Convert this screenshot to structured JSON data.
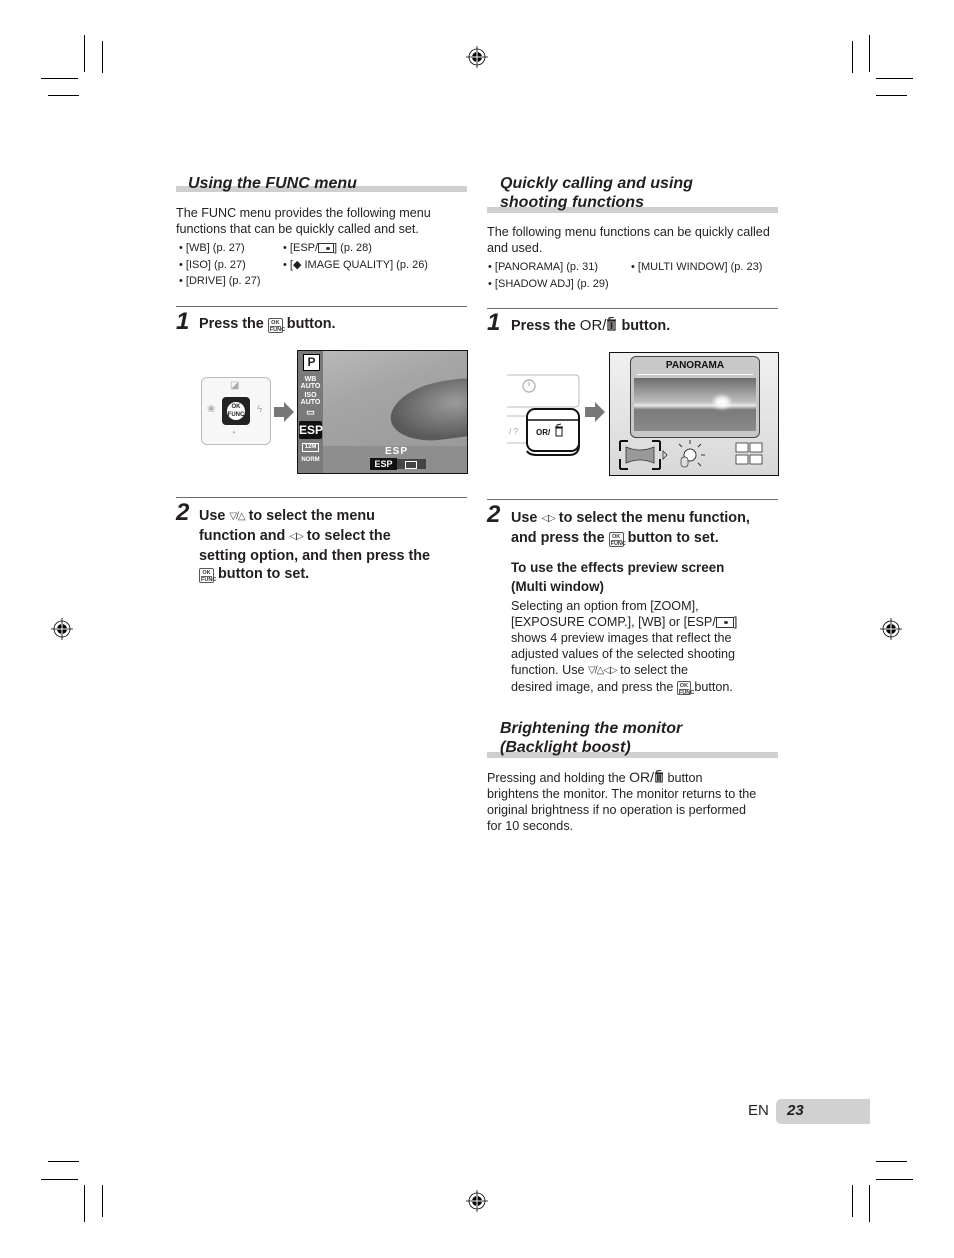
{
  "page": {
    "language": "EN",
    "number": "23"
  },
  "left": {
    "section_title": "Using the FUNC menu",
    "intro": "The FUNC menu provides the following menu functions that can be quickly called and set.",
    "bullets_col1": [
      "[WB] (p. 27)",
      "[ISO] (p. 27)",
      "[DRIVE] (p. 27)"
    ],
    "bullets_col2_esp_prefix": "[ESP/",
    "bullets_col2_esp_suffix": "] (p. 28)",
    "bullets_col2_quality": "[◆ IMAGE QUALITY] (p. 26)",
    "step1": {
      "number": "1",
      "prefix": "Press the",
      "suffix": "button."
    },
    "step2": {
      "number": "2",
      "line1_prefix": "Use",
      "line1_suffix": "to select the menu",
      "line2_prefix": "function and",
      "line2_suffix": "to select the",
      "line3": "setting option, and then press the",
      "line4_suffix": "button to set."
    },
    "illustration": {
      "ok_top": "OK",
      "ok_bottom": "FUNC",
      "mode": "P",
      "side_items": [
        "WB AUTO",
        "ISO AUTO",
        "▭",
        "ESP",
        "12M",
        "NORM"
      ],
      "selected": "ESP",
      "bottom_label": "ESP",
      "option_selected": "ESP"
    }
  },
  "right": {
    "section1_title_line1": "Quickly calling and using",
    "section1_title_line2": "shooting functions",
    "intro": "The following menu functions can be quickly called and used.",
    "bullets_col1": [
      "[PANORAMA] (p. 31)",
      "[SHADOW ADJ] (p. 29)"
    ],
    "bullets_col2": [
      "[MULTI WINDOW] (p. 23)"
    ],
    "step1": {
      "number": "1",
      "prefix": "Press the",
      "or_label": "OR/",
      "suffix": "button."
    },
    "illustration": {
      "button_label": "OR/",
      "screen_title": "PANORAMA"
    },
    "step2": {
      "number": "2",
      "line1_prefix": "Use",
      "line1_suffix": "to select the menu function,",
      "line2_prefix": "and press the",
      "line2_suffix": "button to set."
    },
    "subhead_line1": "To use the effects preview screen",
    "subhead_line2": "(Multi window)",
    "multi_lines": [
      "Selecting an option from [ZOOM],",
      "[EXPOSURE COMP.], [WB] or [ESP/",
      "shows 4 preview images that reflect the",
      "adjusted values of the selected shooting",
      "function. Use",
      "to select the",
      "desired image, and press the",
      "button."
    ],
    "section2_title_line1": "Brightening the monitor",
    "section2_title_line2": "(Backlight boost)",
    "backlight_prefix": "Pressing and holding the",
    "backlight_or": "OR/",
    "backlight_suffix": "button",
    "backlight_lines": [
      "brightens the monitor. The monitor returns to the",
      "original brightness if no operation is performed",
      "for 10 seconds."
    ]
  },
  "icons": {
    "ok_top": "OK",
    "ok_bottom": "FUNC",
    "updown_keys": "▽/△",
    "leftright_keys": "◁▷"
  }
}
